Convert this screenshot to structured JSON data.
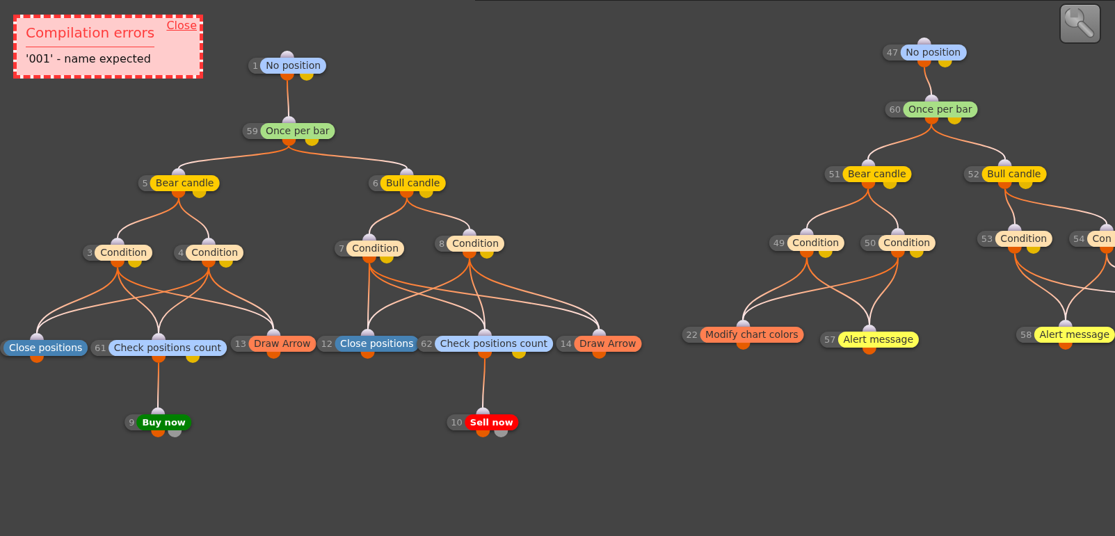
{
  "error_panel": {
    "title": "Compilation errors",
    "close_label": "Close",
    "message": "'001' - name expected"
  },
  "nodes": [
    {
      "number": "1",
      "label": "No position",
      "color": "#a9c9ff",
      "kind": "block",
      "ports": [
        {
          "color": "#e65c00"
        },
        {
          "color": "#e6b800"
        }
      ]
    },
    {
      "number": "59",
      "label": "Once per bar",
      "color": "#a8df86",
      "kind": "block",
      "ports": [
        {
          "color": "#e65c00"
        },
        {
          "color": "#e6b800"
        }
      ]
    },
    {
      "number": "5",
      "label": "Bear candle",
      "color": "#ffcc00",
      "kind": "block",
      "ports": [
        {
          "color": "#e65c00"
        },
        {
          "color": "#e6b800"
        }
      ]
    },
    {
      "number": "6",
      "label": "Bull candle",
      "color": "#ffcc00",
      "kind": "block",
      "ports": [
        {
          "color": "#e65c00"
        },
        {
          "color": "#e6b800"
        }
      ]
    },
    {
      "number": "3",
      "label": "Condition",
      "color": "#ffdfae",
      "kind": "block",
      "ports": [
        {
          "color": "#e65c00"
        },
        {
          "color": "#e6b800"
        }
      ]
    },
    {
      "number": "4",
      "label": "Condition",
      "color": "#ffdfae",
      "kind": "block",
      "ports": [
        {
          "color": "#e65c00"
        },
        {
          "color": "#e6b800"
        }
      ]
    },
    {
      "label": "Close positions",
      "color": "#4682b4",
      "kind": "block",
      "ports": [
        {
          "color": "#e65c00"
        }
      ]
    },
    {
      "number": "61",
      "label": "Check positions count",
      "color": "#aaccff",
      "kind": "block",
      "ports": [
        {
          "color": "#e65c00"
        },
        {
          "color": "#e6b800"
        }
      ]
    },
    {
      "number": "13",
      "label": "Draw Arrow",
      "color": "#ff7f50",
      "kind": "block",
      "ports": [
        {
          "color": "#e65c00"
        }
      ]
    },
    {
      "number": "7",
      "label": "Condition",
      "color": "#ffdfae",
      "kind": "block",
      "ports": [
        {
          "color": "#e65c00"
        },
        {
          "color": "#e6b800"
        }
      ]
    },
    {
      "number": "8",
      "label": "Condition",
      "color": "#ffdfae",
      "kind": "block",
      "ports": [
        {
          "color": "#e65c00"
        },
        {
          "color": "#e6b800"
        }
      ]
    },
    {
      "number": "12",
      "label": "Close positions",
      "color": "#4682b4",
      "kind": "block",
      "ports": [
        {
          "color": "#e65c00"
        }
      ]
    },
    {
      "number": "62",
      "label": "Check positions count",
      "color": "#aaccff",
      "kind": "block",
      "ports": [
        {
          "color": "#e65c00"
        },
        {
          "color": "#e6b800"
        }
      ]
    },
    {
      "number": "14",
      "label": "Draw Arrow",
      "color": "#ff7f50",
      "kind": "block",
      "ports": [
        {
          "color": "#e65c00"
        }
      ]
    },
    {
      "number": "9",
      "label": "Buy now",
      "color": "#008000",
      "kind": "order",
      "ports": [
        {
          "color": "#e65c00"
        },
        {
          "color": "#999999"
        }
      ]
    },
    {
      "number": "10",
      "label": "Sell now",
      "color": "#ff0000",
      "kind": "order",
      "ports": [
        {
          "color": "#e65c00"
        },
        {
          "color": "#999999"
        }
      ]
    },
    {
      "number": "47",
      "label": "No position",
      "color": "#a9c9ff",
      "kind": "block",
      "ports": [
        {
          "color": "#e65c00"
        },
        {
          "color": "#e6b800"
        }
      ]
    },
    {
      "number": "60",
      "label": "Once per bar",
      "color": "#a8df86",
      "kind": "block",
      "ports": [
        {
          "color": "#e65c00"
        },
        {
          "color": "#e6b800"
        }
      ]
    },
    {
      "number": "51",
      "label": "Bear candle",
      "color": "#ffcc00",
      "kind": "block",
      "ports": [
        {
          "color": "#e65c00"
        },
        {
          "color": "#e6b800"
        }
      ]
    },
    {
      "number": "52",
      "label": "Bull candle",
      "color": "#ffcc00",
      "kind": "block",
      "ports": [
        {
          "color": "#e65c00"
        },
        {
          "color": "#e6b800"
        }
      ]
    },
    {
      "number": "49",
      "label": "Condition",
      "color": "#ffdfae",
      "kind": "block",
      "ports": [
        {
          "color": "#e65c00"
        },
        {
          "color": "#e6b800"
        }
      ]
    },
    {
      "number": "50",
      "label": "Condition",
      "color": "#ffdfae",
      "kind": "block",
      "ports": [
        {
          "color": "#e65c00"
        },
        {
          "color": "#e6b800"
        }
      ]
    },
    {
      "number": "53",
      "label": "Condition",
      "color": "#ffdfae",
      "kind": "block",
      "ports": [
        {
          "color": "#e65c00"
        },
        {
          "color": "#e6b800"
        }
      ]
    },
    {
      "number": "54",
      "label": "Con",
      "color": "#ffdfae",
      "kind": "block",
      "ports": [
        {
          "color": "#e65c00"
        }
      ]
    },
    {
      "number": "22",
      "label": "Modify chart colors",
      "color": "#ff7f50",
      "kind": "block",
      "ports": [
        {
          "color": "#e65c00"
        }
      ]
    },
    {
      "number": "57",
      "label": "Alert message",
      "color": "#ffff55",
      "kind": "block",
      "ports": [
        {
          "color": "#e65c00"
        }
      ]
    },
    {
      "number": "58",
      "label": "Alert message",
      "color": "#ffff55",
      "kind": "block",
      "ports": [
        {
          "color": "#e65c00"
        }
      ]
    }
  ]
}
